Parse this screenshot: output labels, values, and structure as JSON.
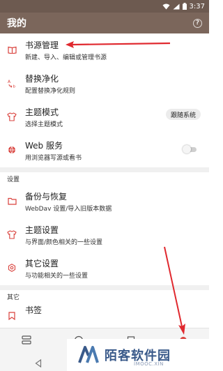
{
  "status_bar": {
    "time": "3:37"
  },
  "app_bar": {
    "title": "我的",
    "help_icon": "help-circle-icon"
  },
  "items": [
    {
      "title": "书源管理",
      "sub": "新建、导入、编辑或管理书源",
      "icon": "book-icon"
    },
    {
      "title": "替换净化",
      "sub": "配置替换净化规则",
      "icon": "replace-icon"
    },
    {
      "title": "主题模式",
      "sub": "选择主题模式",
      "icon": "shirt-icon",
      "trail": "跟随系统"
    },
    {
      "title": "Web 服务",
      "sub": "用浏览器写源或看书",
      "icon": "globe-icon",
      "toggle": false
    }
  ],
  "settings_section": {
    "header": "设置",
    "items": [
      {
        "title": "备份与恢复",
        "sub": "WebDav 设置/导入旧版本数据",
        "icon": "folder-icon"
      },
      {
        "title": "主题设置",
        "sub": "与界面/颜色相关的一些设置",
        "icon": "shirt-icon"
      },
      {
        "title": "其它设置",
        "sub": "与功能相关的一些设置",
        "icon": "settings-icon"
      }
    ]
  },
  "other_section": {
    "header": "其它",
    "items": [
      {
        "title": "书签",
        "icon": "bookmark-icon"
      }
    ]
  },
  "watermark": {
    "text": "陌客软件园",
    "sub": "IMOOC.XIN"
  },
  "colors": {
    "status_bar": "#6d5a50",
    "app_bar": "#7b665b",
    "icon_accent": "#d9413c",
    "arrow": "#e0282e"
  }
}
